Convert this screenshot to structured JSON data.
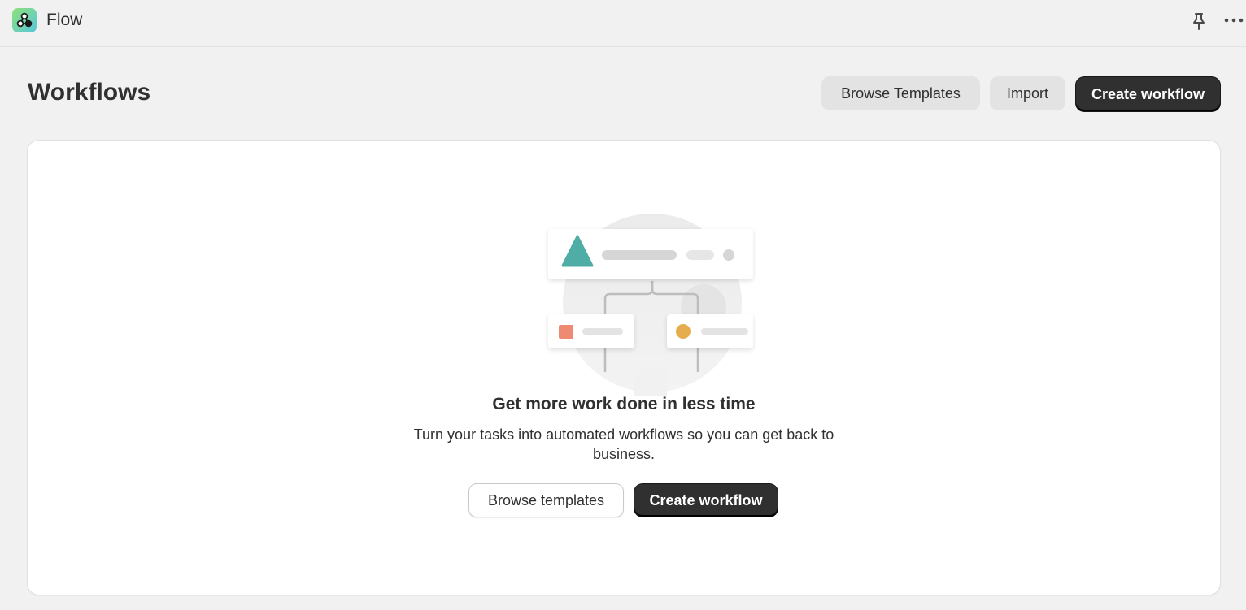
{
  "app": {
    "title": "Flow",
    "icons": {
      "logo": "flow-logo-icon",
      "pin": "pin-icon",
      "more": "more-horizontal-icon"
    }
  },
  "header": {
    "title": "Workflows",
    "browse_templates_label": "Browse Templates",
    "import_label": "Import",
    "create_workflow_label": "Create workflow"
  },
  "empty_state": {
    "heading": "Get more work done in less time",
    "description": "Turn your tasks into automated workflows so you can get back to business.",
    "browse_templates_label": "Browse templates",
    "create_workflow_label": "Create workflow"
  },
  "colors": {
    "accent_dark": "#303030",
    "teal": "#4fada6",
    "coral": "#ee8a74",
    "amber": "#e6ad4f"
  }
}
